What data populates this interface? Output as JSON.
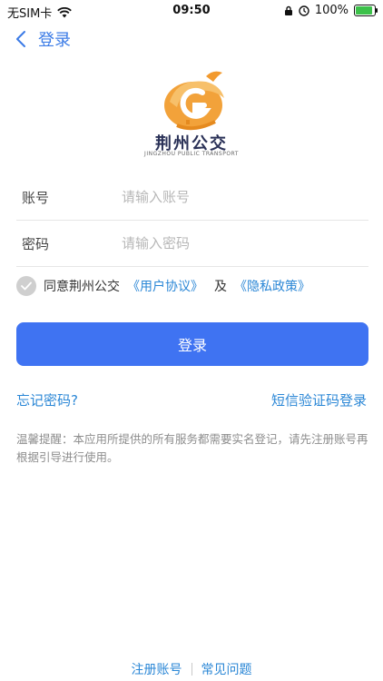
{
  "status_bar": {
    "carrier": "无SIM卡",
    "time": "09:50",
    "battery": "100%",
    "battery_level": 1.0,
    "icons": [
      "wifi-icon",
      "lock-rotation-icon",
      "alarm-icon",
      "battery-icon"
    ]
  },
  "nav": {
    "back_label": "登录"
  },
  "logo": {
    "title": "荆州公交",
    "subtitle": "JINGZHOU PUBLIC TRANSPORT"
  },
  "form": {
    "account_label": "账号",
    "account_placeholder": "请输入账号",
    "account_value": "",
    "password_label": "密码",
    "password_placeholder": "请输入密码",
    "password_value": ""
  },
  "agreement": {
    "prefix": "同意荆州公交",
    "user_agreement": "《用户协议》",
    "and": "及",
    "privacy_policy": "《隐私政策》",
    "checked": false
  },
  "login_button": "登录",
  "links": {
    "forgot_password": "忘记密码?",
    "sms_login": "短信验证码登录"
  },
  "tip": "温馨提醒：本应用所提供的所有服务都需要实名登记，请先注册账号再根据引导进行使用。",
  "footer": {
    "register": "注册账号",
    "faq": "常见问题"
  },
  "colors": {
    "accent": "#3f73f2",
    "link": "#2b87d6",
    "logo_orange": "#f29a2e",
    "logo_navy": "#2a3157"
  }
}
